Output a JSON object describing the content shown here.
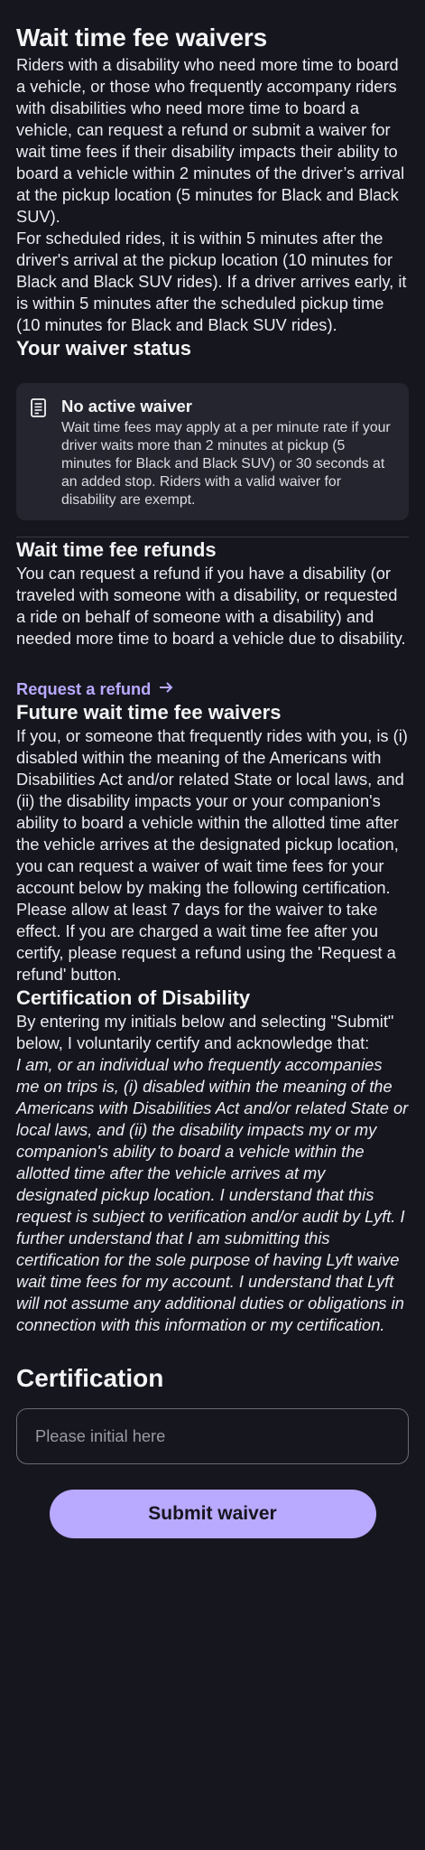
{
  "header": {
    "title": "Wait time fee waivers"
  },
  "intro": {
    "p1": "Riders with a disability who need more time to board a vehicle, or those who frequently accompany riders with disabilities who need more time to board a vehicle, can request a refund or submit a waiver for wait time fees if their disability impacts their ability to board a vehicle within 2 minutes of the driver’s arrival at the pickup location (5 minutes for Black and Black SUV).",
    "p2": "For scheduled rides, it is within 5 minutes after the driver's arrival at the pickup location (10 minutes for Black and Black SUV rides). If a driver arrives early, it is within 5 minutes after the scheduled pickup time (10 minutes for Black and Black SUV rides)."
  },
  "status": {
    "heading": "Your waiver status",
    "icon": "document-icon",
    "card_title": "No active waiver",
    "card_text": "Wait time fees may apply at a per minute rate if your driver waits more than 2 minutes at pickup (5 minutes for Black and Black SUV) or 30 seconds at an added stop. Riders with a valid waiver for disability are exempt."
  },
  "refunds": {
    "heading": "Wait time fee refunds",
    "text": "You can request a refund if you have a disability (or traveled with someone with a disability, or requested a ride on behalf of someone with a disability) and needed more time to board a vehicle due to disability.",
    "link_label": "Request a refund",
    "link_icon": "arrow-right-icon"
  },
  "future": {
    "heading": "Future wait time fee waivers",
    "p1": "If you, or someone that frequently rides with you, is (i) disabled within the meaning of the Americans with Disabilities Act and/or related State or local laws, and (ii) the disability impacts your or your companion's ability to board a vehicle within the allotted time after the vehicle arrives at the designated pickup location, you can request a waiver of wait time fees for your account below by making the following certification.",
    "p2": "Please allow at least 7 days for the waiver to take effect. If you are charged a wait time fee after you certify, please request a refund using the 'Request a refund' button."
  },
  "certification_disability": {
    "heading": "Certification of Disability",
    "p1": "By entering my initials below and selecting \"Submit\" below, I voluntarily certify and acknowledge that:",
    "statement": "I am, or an individual who frequently accompanies me on trips is, (i) disabled within the meaning of the Americans with Disabilities Act and/or related State or local laws, and (ii) the disability impacts my or my companion's ability to board a vehicle within the allotted time after the vehicle arrives at my designated pickup location. I understand that this request is subject to verification and/or audit by Lyft. I further understand that I am submitting this certification for the sole purpose of having Lyft waive wait time fees for my account. I understand that Lyft will not assume any additional duties or obligations in connection with this information or my certification."
  },
  "certification": {
    "heading": "Certification",
    "input_value": "",
    "input_placeholder": "Please initial here",
    "submit_label": "Submit waiver"
  },
  "colors": {
    "background": "#16161e",
    "card": "#25252f",
    "accent": "#b9a9ff",
    "text": "#f4f4f6"
  }
}
